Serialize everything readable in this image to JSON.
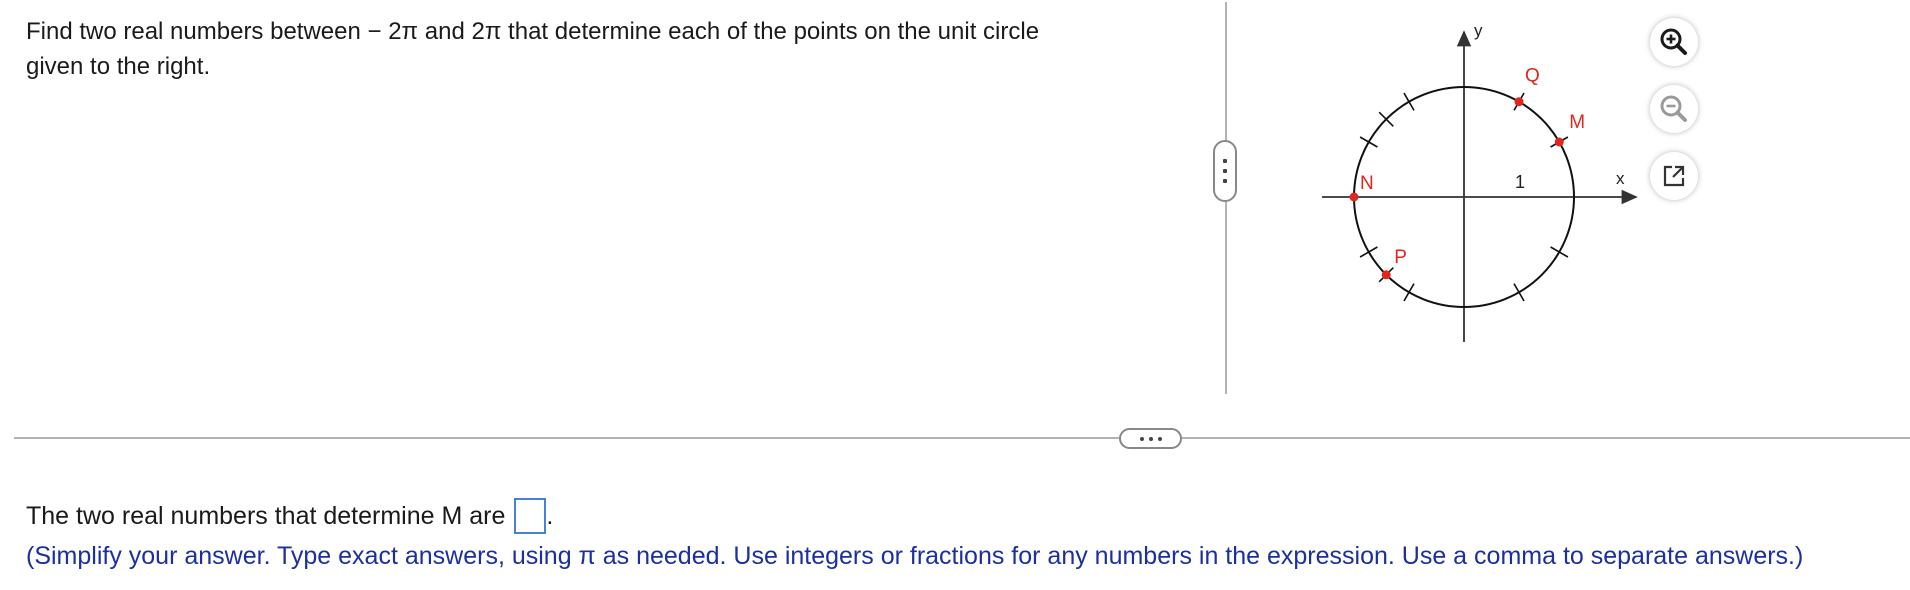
{
  "question": {
    "line1": "Find two real numbers between  − 2π and 2π that determine each of the points on the unit circle",
    "line2": "given to the right."
  },
  "figure": {
    "x_axis_label": "x",
    "y_axis_label": "y",
    "unit_label": "1",
    "points": [
      {
        "label": "Q",
        "angle_deg": 60
      },
      {
        "label": "M",
        "angle_deg": 30
      },
      {
        "label": "N",
        "angle_deg": 180
      },
      {
        "label": "P",
        "angle_deg": 225
      }
    ],
    "tick_angles_deg": [
      30,
      60,
      120,
      135,
      150,
      210,
      225,
      240,
      300,
      330
    ],
    "point_color": "#e0271f"
  },
  "toolbar": {
    "zoom_in": "zoom-in-icon",
    "zoom_out": "zoom-out-icon",
    "popout": "popout-icon"
  },
  "answer": {
    "prompt": "The two real numbers that determine M are",
    "period": ".",
    "value": ""
  },
  "hint": "(Simplify your answer. Type exact answers, using π as needed. Use integers or fractions for any numbers in the expression. Use a comma to separate answers.)"
}
